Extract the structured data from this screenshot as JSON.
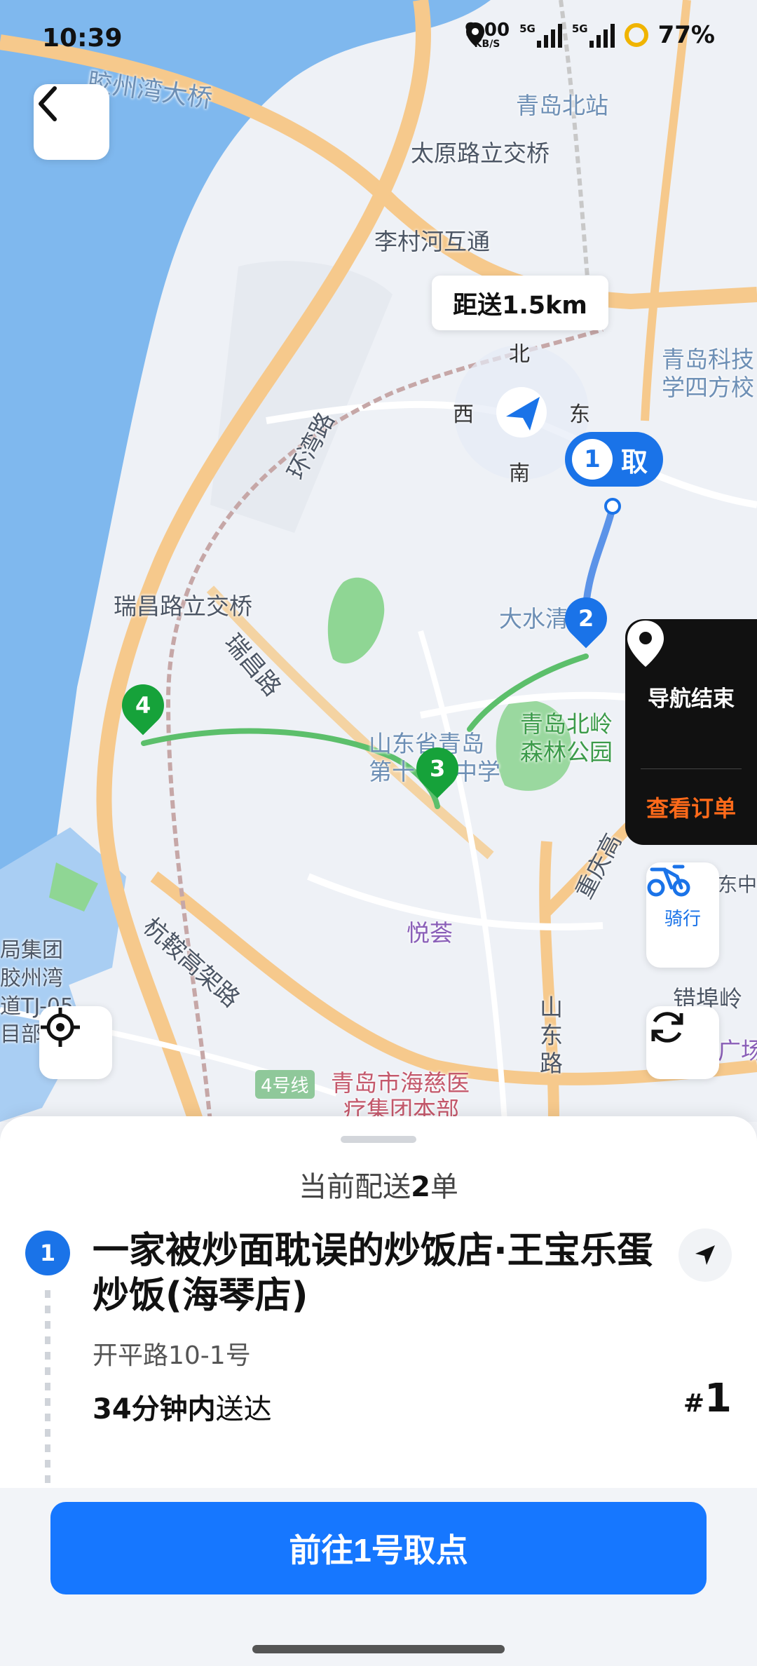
{
  "status_bar": {
    "time": "10:39",
    "net_speed_value": "9.00",
    "net_speed_unit": "KB/S",
    "net1": "5G",
    "net2": "5G",
    "battery": "77%"
  },
  "map": {
    "labels": {
      "l1": "胶州湾大桥",
      "l2": "青岛北站",
      "l3": "太原路立交桥",
      "l4": "李村河互通",
      "l5": "青岛科技",
      "l6": "学四方校",
      "l7": "环湾路",
      "l8": "瑞昌路立交桥",
      "l9": "瑞昌路",
      "l10": "大水清",
      "l11": "青岛北岭",
      "l12": "森林公园",
      "l13": "山东省青岛",
      "l14": "第十",
      "l15": "中学",
      "l16": "重庆高",
      "l17": "悦荟",
      "l18": "杭鞍高架路",
      "l19": "山",
      "l20": "东",
      "l21": "路",
      "l22": "局集团",
      "l23": "胶州湾",
      "l24": "道TJ-05",
      "l25": "目部",
      "l26": "4号线",
      "l27": "青岛市海慈医",
      "l28": "疗集团本部",
      "l29": "错埠岭",
      "l30": "广场",
      "l31": "东中心"
    },
    "compass": {
      "north": "北",
      "south": "南",
      "west": "西",
      "east": "东"
    },
    "distance_label": "距送1.5km",
    "pickup_marker": {
      "number": "1",
      "label": "取"
    },
    "route_markers": [
      "2",
      "3",
      "4"
    ],
    "navigation_end_label": "导航结束",
    "view_order_label": "查看订单",
    "ride_mode_label": "骑行"
  },
  "sheet": {
    "count_prefix": "当前配送",
    "count_number": "2",
    "count_suffix": "单",
    "order": {
      "index": "1",
      "shop_name": "一家被炒面耽误的炒饭店·王宝乐蛋炒饭(海琴店)",
      "address": "开平路10-1号",
      "eta_bold": "34分钟内",
      "eta_rest": "送达",
      "order_prefix": "#",
      "order_number": "1"
    }
  },
  "footer": {
    "primary_button": "前往1号取点"
  },
  "colors": {
    "accent": "#1677ff",
    "route_green": "#16a23a",
    "orange": "#ff6a1a"
  }
}
